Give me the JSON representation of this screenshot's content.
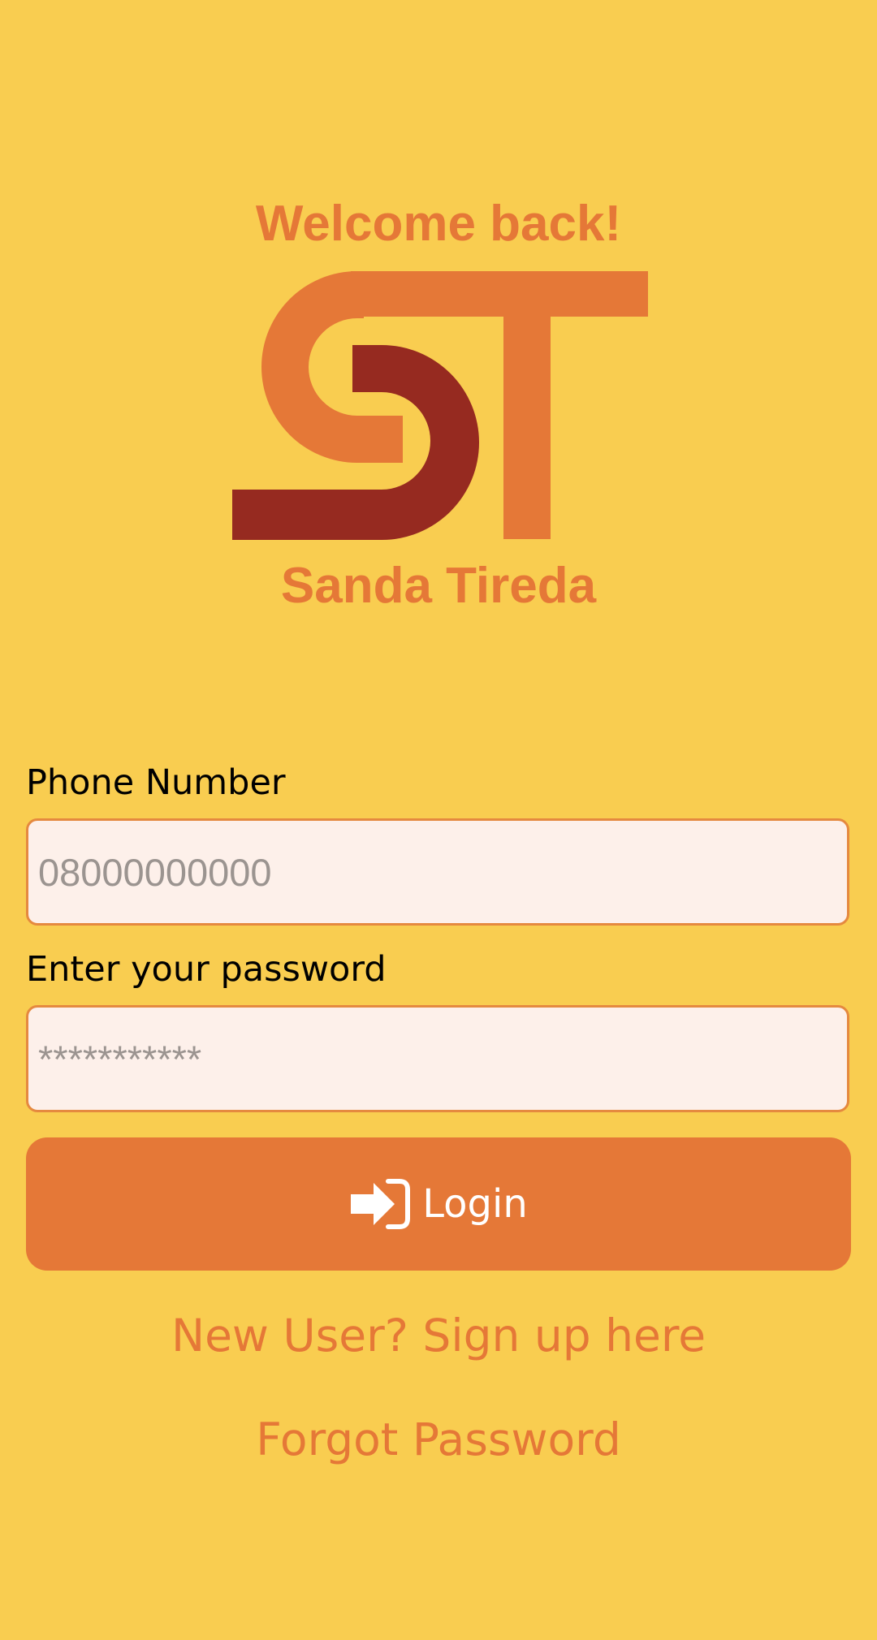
{
  "header": {
    "welcome_text": "Welcome back!",
    "brand_name": "Sanda Tireda",
    "logo_text": "ST"
  },
  "form": {
    "phone": {
      "label": "Phone Number",
      "placeholder": "08000000000",
      "value": ""
    },
    "password": {
      "label": "Enter your password",
      "placeholder": "***********",
      "value": ""
    },
    "login_button": {
      "label": "Login",
      "icon": "sign-in-icon"
    }
  },
  "links": {
    "signup": "New User? Sign up here",
    "forgot_password": "Forgot Password"
  },
  "colors": {
    "background": "#F9CD50",
    "accent": "#E57837",
    "logo_dark": "#962A20",
    "input_background": "#FDF0EA",
    "input_border": "#E5893F",
    "placeholder": "#9B9490"
  }
}
